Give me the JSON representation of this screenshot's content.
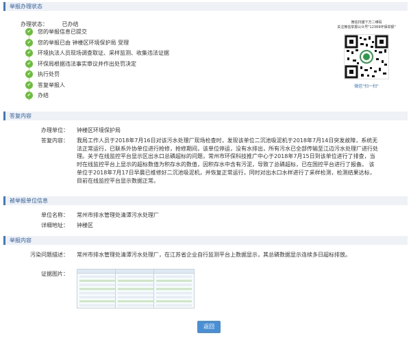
{
  "sections": {
    "status": "举报办理状态",
    "reply": "答复内容",
    "reported": "被举报单位信息",
    "report": "举报内容"
  },
  "status": {
    "label": "办理状态：",
    "value": "已办结"
  },
  "timeline": [
    "您的举报信息已提交",
    "您的举报已由 钟楼区环境保护局 受理",
    "环境执法人员现场调查取证、采样监测、收集违法证据",
    "环保局根据违法事实审议并作出处罚决定",
    "执行处罚",
    "答复举报人",
    "办结"
  ],
  "qr": {
    "caption_line1": "微信扫描下方二维码",
    "caption_line2": "关注微信举报公众号\"12369环保举报\"",
    "caption_line3": "微信\"扫一扫\""
  },
  "reply": {
    "unit_label": "办理单位：",
    "unit_value": "钟楼区环境保护局",
    "content_label": "答复内容：",
    "content_value": "我局工作人员于2018年7月16日对该污水处理厂现场检查时，发现该单位二沉池吸泥机于2018年7月14日突发故障，系统无法正常运行，已联系外协单位进行抢修，抢修期间，该单位停运，没有水排出，所有污水已全部传输至江边污水处理厂进行处理。关于在线监控平台显示区出水口总磷超标的问题，常州市环保科技推广中心于2018年7月15日到该单位进行了排查，当时在线监控平台上显示的超标数值为积存水的数值，因积存水中含有污泥，导致了总磷超标，已在国控平台进行了报备。 该单位于2018年7月17日早晨已维修好二沉池吸泥机，并恢复正常运行，同时对出水口水样进行了采样检测，检测结果达标，目前在线监控平台显示数据正常。"
  },
  "reported": {
    "name_label": "单位名称：",
    "name_value": "常州市排水管理处清潭污水处理厂",
    "addr_label": "详细地址：",
    "addr_value": "钟楼区"
  },
  "report": {
    "desc_label": "污染问题描述：",
    "desc_value": "常州市排水管理处清潭污水处理厂，在江苏省企业自行监测平台上数据显示，其总磷数据显示连续多日超标排放。",
    "images_label": "证据图片："
  },
  "buttons": {
    "back": "返回"
  },
  "colors": {
    "accent": "#3d7bbf",
    "check_green": "#6abf3a",
    "button_blue": "#4a8fd3"
  }
}
